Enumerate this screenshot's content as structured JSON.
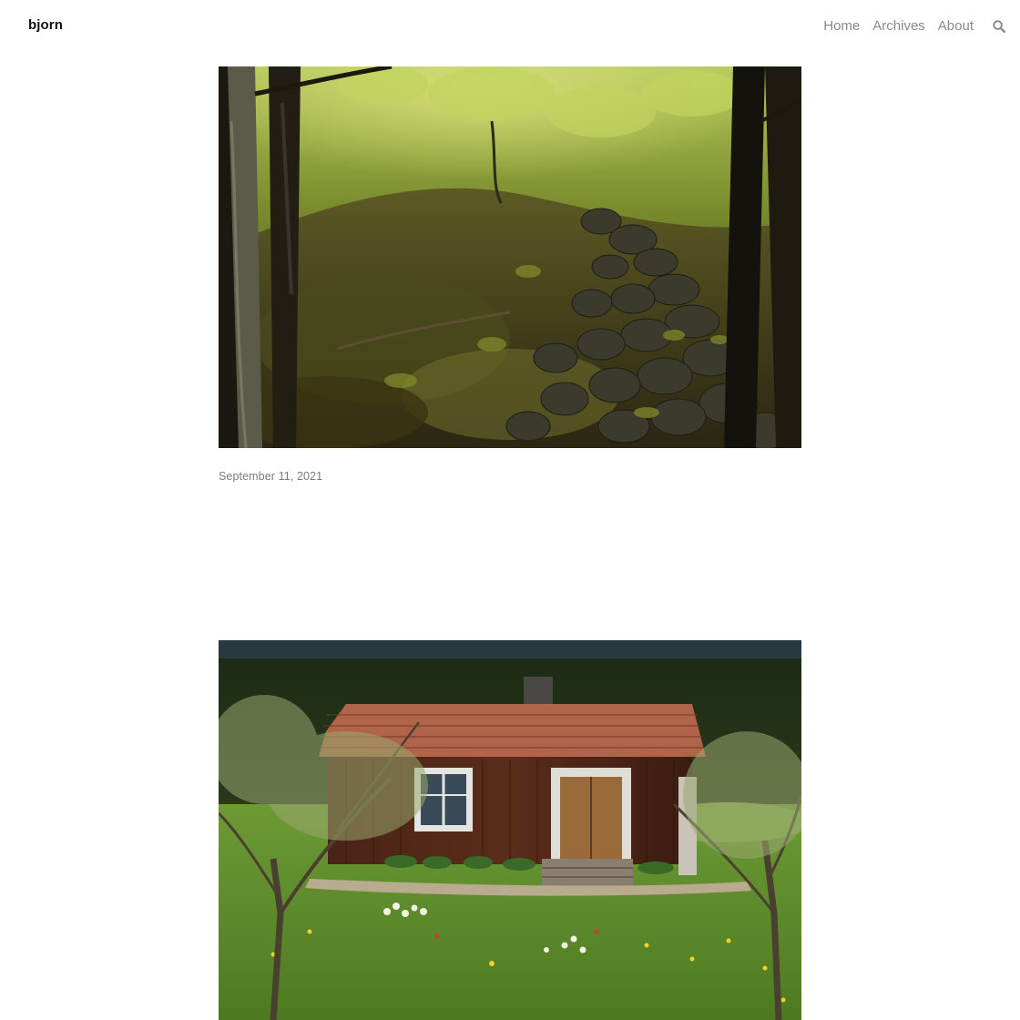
{
  "site": {
    "title": "bjorn"
  },
  "nav": {
    "items": [
      "Home",
      "Archives",
      "About"
    ],
    "search_icon": "search-icon"
  },
  "posts": [
    {
      "image": "forest-stone-wall-photo",
      "date": "September 11, 2021"
    },
    {
      "image": "red-wooden-cottage-photo",
      "date": ""
    }
  ],
  "colors": {
    "text_primary": "#111111",
    "text_muted": "#8a8a8a",
    "background": "#ffffff"
  }
}
